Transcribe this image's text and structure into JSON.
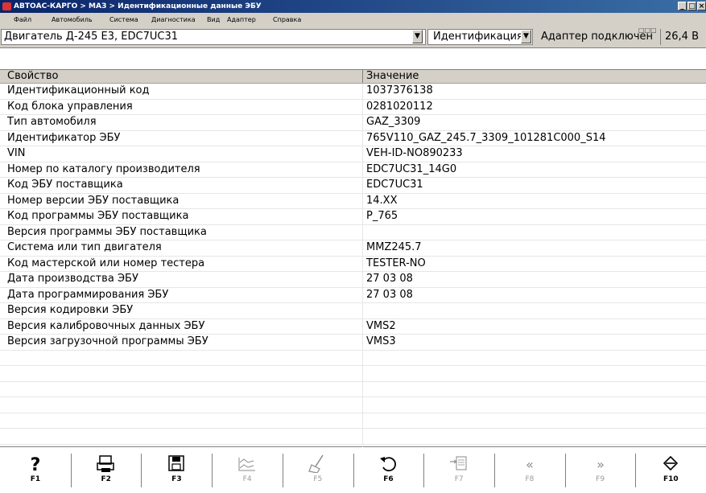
{
  "window": {
    "title": "АВТОАС-КАРГО > МАЗ > Идентификационные данные ЭБУ",
    "controls": [
      "_",
      "□",
      "×"
    ]
  },
  "menu": [
    "Файл",
    "Автомобиль",
    "Система",
    "Диагностика",
    "Вид",
    "Адаптер",
    "Справка"
  ],
  "toolbar": {
    "engine": "Двигатель Д-245 Е3, EDC7UC31",
    "mode": "Идентификация",
    "adapter_status": "Адаптер подключен",
    "voltage": "26,4 В",
    "status_squares": "□□□"
  },
  "table": {
    "columns": [
      "Свойство",
      "Значение"
    ],
    "rows": [
      {
        "property": "Идентификационный код",
        "value": "1037376138"
      },
      {
        "property": "Код блока управления",
        "value": "0281020112"
      },
      {
        "property": "Тип автомобиля",
        "value": "GAZ_3309"
      },
      {
        "property": "Идентификатор ЭБУ",
        "value": "765V110_GAZ_245.7_3309_101281C000_S14"
      },
      {
        "property": "VIN",
        "value": "VEH-ID-NO890233"
      },
      {
        "property": "Номер по каталогу производителя",
        "value": "EDC7UC31_14G0"
      },
      {
        "property": "Код ЭБУ поставщика",
        "value": "EDC7UC31"
      },
      {
        "property": "Номер версии ЭБУ поставщика",
        "value": "14.XX"
      },
      {
        "property": "Код программы ЭБУ поставщика",
        "value": "P_765"
      },
      {
        "property": "Версия программы ЭБУ поставщика",
        "value": ""
      },
      {
        "property": "Система или тип двигателя",
        "value": "MMZ245.7"
      },
      {
        "property": "Код мастерской или номер тестера",
        "value": "TESTER-NO"
      },
      {
        "property": "Дата производства ЭБУ",
        "value": "27 03 08"
      },
      {
        "property": "Дата программирования ЭБУ",
        "value": "27 03 08"
      },
      {
        "property": "Версия кодировки ЭБУ",
        "value": ""
      },
      {
        "property": "Версия калибровочных данных ЭБУ",
        "value": "VMS2"
      },
      {
        "property": "Версия загрузочной программы ЭБУ",
        "value": "VMS3"
      },
      {
        "property": "",
        "value": ""
      },
      {
        "property": "",
        "value": ""
      },
      {
        "property": "",
        "value": ""
      },
      {
        "property": "",
        "value": ""
      },
      {
        "property": "",
        "value": ""
      },
      {
        "property": "",
        "value": ""
      },
      {
        "property": "",
        "value": ""
      }
    ]
  },
  "function_keys": [
    {
      "label": "F1",
      "icon": "help-icon",
      "enabled": true
    },
    {
      "label": "F2",
      "icon": "print-icon",
      "enabled": true
    },
    {
      "label": "F3",
      "icon": "save-icon",
      "enabled": true
    },
    {
      "label": "F4",
      "icon": "graph-icon",
      "enabled": false
    },
    {
      "label": "F5",
      "icon": "broom-icon",
      "enabled": false
    },
    {
      "label": "F6",
      "icon": "refresh-icon",
      "enabled": true
    },
    {
      "label": "F7",
      "icon": "import-icon",
      "enabled": false
    },
    {
      "label": "F8",
      "icon": "rewind-icon",
      "enabled": false
    },
    {
      "label": "F9",
      "icon": "forward-icon",
      "enabled": false
    },
    {
      "label": "F10",
      "icon": "exit-icon",
      "enabled": true
    }
  ]
}
